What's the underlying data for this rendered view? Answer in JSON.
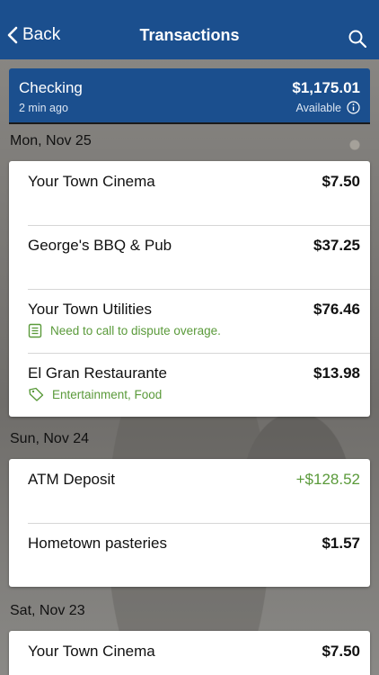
{
  "navbar": {
    "back_label": "Back",
    "title": "Transactions",
    "back_icon": "chevron-left-icon",
    "search_icon": "search-icon"
  },
  "account": {
    "name": "Checking",
    "updated": "2 min ago",
    "balance": "$1,175.01",
    "balance_label": "Available",
    "info_icon": "info-icon"
  },
  "groups": [
    {
      "date": "Mon, Nov 25",
      "transactions": [
        {
          "name": "Your Town Cinema",
          "amount": "$7.50"
        },
        {
          "name": "George's BBQ & Pub",
          "amount": "$37.25"
        },
        {
          "name": "Your Town Utilities",
          "amount": "$76.46",
          "note": "Need to call to dispute overage.",
          "note_icon": "note-icon"
        },
        {
          "name": "El Gran Restaurante",
          "amount": "$13.98",
          "note": "Entertainment, Food",
          "note_icon": "tag-icon"
        }
      ]
    },
    {
      "date": "Sun, Nov 24",
      "transactions": [
        {
          "name": "ATM Deposit",
          "amount": "+$128.52",
          "type": "credit"
        },
        {
          "name": "Hometown pasteries",
          "amount": "$1.57"
        }
      ]
    },
    {
      "date": "Sat, Nov 23",
      "transactions": [
        {
          "name": "Your Town Cinema",
          "amount": "$7.50"
        }
      ]
    }
  ],
  "colors": {
    "brand": "#1b4f8e",
    "credit": "#5a9a3a"
  }
}
